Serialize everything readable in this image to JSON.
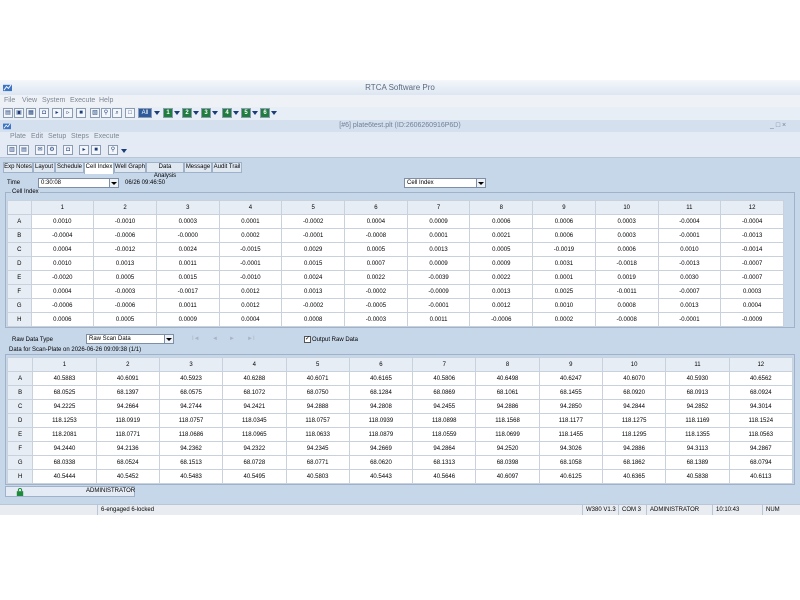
{
  "app": {
    "title": "RTCA Software Pro"
  },
  "menu": [
    "File",
    "View",
    "System",
    "Execute",
    "Help"
  ],
  "toolbar": {
    "all_label": "All",
    "dev1": "1",
    "dev2": "2",
    "dev3": "3",
    "dev4": "4",
    "dev5": "5",
    "dev6": "6"
  },
  "doc": {
    "title": "[#6] plate6test.plt (ID:2606260916P6D)",
    "controls": "_ □ ×"
  },
  "doc_menu": [
    "Plate",
    "Edit",
    "Setup",
    "Steps",
    "Execute"
  ],
  "tabs": [
    "Exp Notes",
    "Layout",
    "Schedule",
    "Cell Index",
    "Well Graph",
    "Data Analysis",
    "Message",
    "Audit Trail"
  ],
  "time": {
    "label": "Time",
    "value": "0:30:08",
    "timestamp": "06/26 09:46:50"
  },
  "view_select": "Cell Index",
  "cell_index": {
    "group_label": "Cell Index",
    "columns": [
      "1",
      "2",
      "3",
      "4",
      "5",
      "6",
      "7",
      "8",
      "9",
      "10",
      "11",
      "12"
    ],
    "rows": [
      {
        "label": "A",
        "values": [
          "0.0010",
          "-0.0010",
          "0.0003",
          "0.0001",
          "-0.0002",
          "0.0004",
          "0.0009",
          "0.0006",
          "0.0006",
          "0.0003",
          "-0.0004",
          "-0.0004"
        ]
      },
      {
        "label": "B",
        "values": [
          "-0.0004",
          "-0.0006",
          "-0.0000",
          "0.0002",
          "-0.0001",
          "-0.0008",
          "0.0001",
          "0.0021",
          "0.0006",
          "0.0003",
          "-0.0001",
          "-0.0013"
        ]
      },
      {
        "label": "C",
        "values": [
          "0.0004",
          "-0.0012",
          "0.0024",
          "-0.0015",
          "0.0029",
          "0.0005",
          "0.0013",
          "0.0005",
          "-0.0019",
          "0.0006",
          "0.0010",
          "-0.0014"
        ]
      },
      {
        "label": "D",
        "values": [
          "0.0010",
          "0.0013",
          "0.0011",
          "-0.0001",
          "0.0015",
          "0.0007",
          "0.0009",
          "0.0009",
          "0.0031",
          "-0.0018",
          "-0.0013",
          "-0.0007"
        ]
      },
      {
        "label": "E",
        "values": [
          "-0.0020",
          "0.0005",
          "0.0015",
          "-0.0010",
          "0.0024",
          "0.0022",
          "-0.0039",
          "0.0022",
          "0.0001",
          "0.0019",
          "0.0030",
          "-0.0007"
        ]
      },
      {
        "label": "F",
        "values": [
          "0.0004",
          "-0.0003",
          "-0.0017",
          "0.0012",
          "0.0013",
          "-0.0002",
          "-0.0009",
          "0.0013",
          "0.0025",
          "-0.0011",
          "-0.0007",
          "0.0003"
        ]
      },
      {
        "label": "G",
        "values": [
          "-0.0006",
          "-0.0006",
          "0.0011",
          "0.0012",
          "-0.0002",
          "-0.0005",
          "-0.0001",
          "0.0012",
          "0.0010",
          "0.0008",
          "0.0013",
          "0.0004"
        ]
      },
      {
        "label": "H",
        "values": [
          "0.0006",
          "0.0005",
          "0.0009",
          "0.0004",
          "0.0008",
          "-0.0003",
          "0.0011",
          "-0.0006",
          "0.0002",
          "-0.0008",
          "-0.0001",
          "-0.0009"
        ]
      }
    ]
  },
  "raw": {
    "type_label": "Raw Data Type",
    "type_value": "Raw Scan Data",
    "nav": [
      "I◄",
      "◄",
      "►",
      "►I"
    ],
    "output_label": "Output Raw Data",
    "output_checked": "✓",
    "caption": "Data for Scan-Plate on 2026-06-26 09:09:38 (1/1)",
    "columns": [
      "1",
      "2",
      "3",
      "4",
      "5",
      "6",
      "7",
      "8",
      "9",
      "10",
      "11",
      "12"
    ],
    "rows": [
      {
        "label": "A",
        "values": [
          "40.5883",
          "40.6091",
          "40.5923",
          "40.6288",
          "40.6071",
          "40.6165",
          "40.5806",
          "40.6498",
          "40.6247",
          "40.6070",
          "40.5930",
          "40.6562"
        ]
      },
      {
        "label": "B",
        "values": [
          "68.0525",
          "68.1397",
          "68.0575",
          "68.1072",
          "68.0750",
          "68.1284",
          "68.0869",
          "68.1061",
          "68.1455",
          "68.0920",
          "68.0913",
          "68.0924"
        ]
      },
      {
        "label": "C",
        "values": [
          "94.2225",
          "94.2664",
          "94.2744",
          "94.2421",
          "94.2888",
          "94.2808",
          "94.2455",
          "94.2886",
          "94.2850",
          "94.2844",
          "94.2852",
          "94.3014"
        ]
      },
      {
        "label": "D",
        "values": [
          "118.1253",
          "118.0919",
          "118.0757",
          "118.0345",
          "118.0757",
          "118.0939",
          "118.0898",
          "118.1568",
          "118.1177",
          "118.1275",
          "118.1169",
          "118.1524"
        ]
      },
      {
        "label": "E",
        "values": [
          "118.2081",
          "118.0771",
          "118.0686",
          "118.0965",
          "118.0633",
          "118.0879",
          "118.0559",
          "118.0699",
          "118.1455",
          "118.1295",
          "118.1355",
          "118.0563"
        ]
      },
      {
        "label": "F",
        "values": [
          "94.2440",
          "94.2136",
          "94.2362",
          "94.2322",
          "94.2345",
          "94.2669",
          "94.2864",
          "94.2520",
          "94.3026",
          "94.2886",
          "94.3113",
          "94.2867"
        ]
      },
      {
        "label": "G",
        "values": [
          "68.0338",
          "68.0524",
          "68.1513",
          "68.0728",
          "68.0771",
          "68.0620",
          "68.1313",
          "68.0398",
          "68.1058",
          "68.1862",
          "68.1389",
          "68.0794"
        ]
      },
      {
        "label": "H",
        "values": [
          "40.5444",
          "40.5452",
          "40.5483",
          "40.5495",
          "40.5803",
          "40.5443",
          "40.5646",
          "40.6097",
          "40.6125",
          "40.6365",
          "40.5838",
          "40.6113"
        ]
      }
    ]
  },
  "user_panel": {
    "user": "ADMINISTRATOR"
  },
  "status": {
    "engaged": "6-engaged  6-locked",
    "version": "W380 V1.3",
    "com": "COM 3",
    "user": "ADMINISTRATOR",
    "time": "10:10:43",
    "num": "NUM"
  }
}
